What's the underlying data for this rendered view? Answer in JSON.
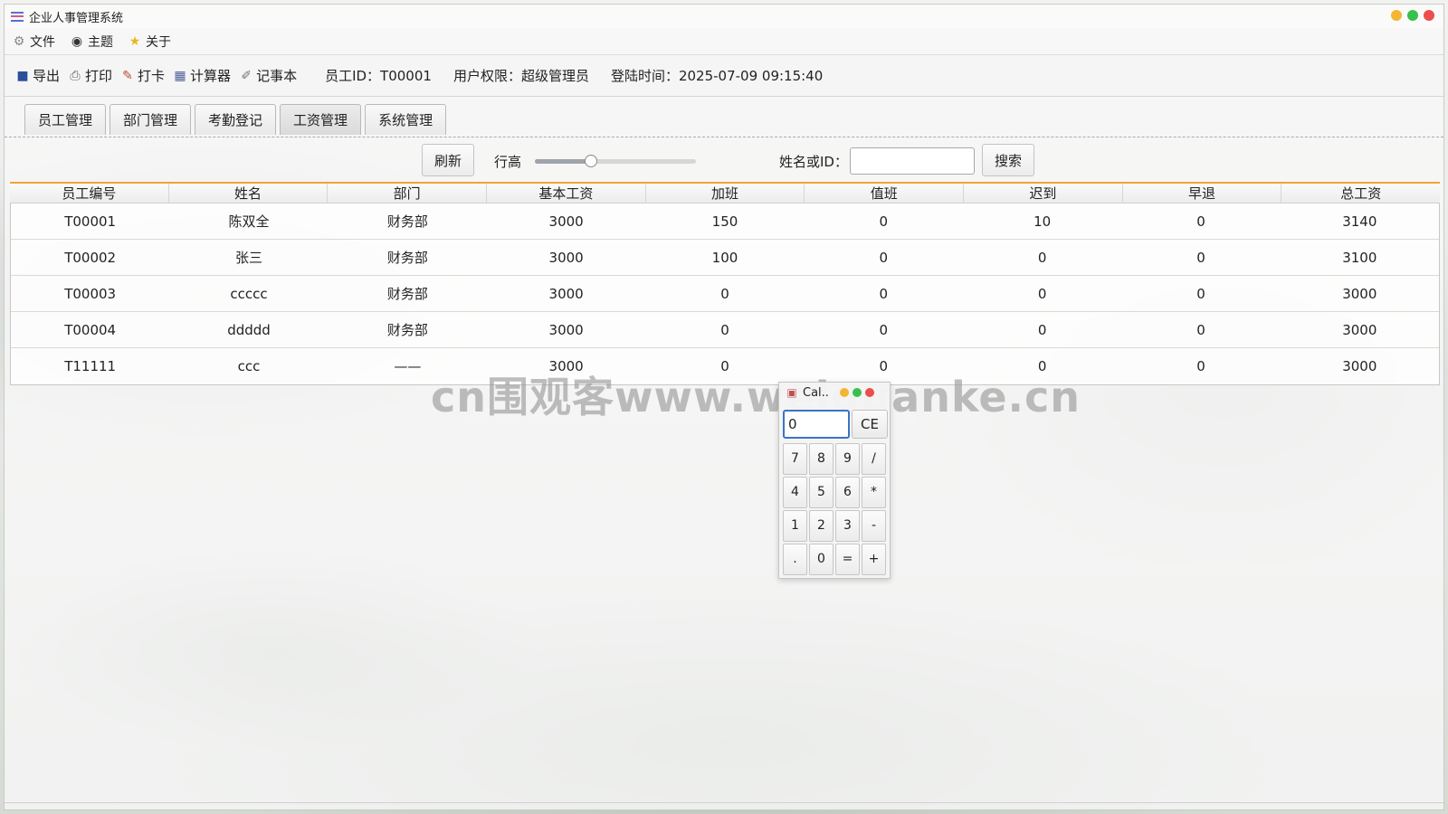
{
  "window": {
    "title": "企业人事管理系统"
  },
  "menu": [
    {
      "label": "文件",
      "icon": "gear-icon"
    },
    {
      "label": "主题",
      "icon": "eye-icon"
    },
    {
      "label": "关于",
      "icon": "star-icon"
    }
  ],
  "toolbar": {
    "tools": [
      {
        "label": "导出",
        "icon": "save-icon"
      },
      {
        "label": "打印",
        "icon": "printer-icon"
      },
      {
        "label": "打卡",
        "icon": "clipboard-check-icon"
      },
      {
        "label": "计算器",
        "icon": "calculator-icon"
      },
      {
        "label": "记事本",
        "icon": "notepad-icon"
      }
    ],
    "employee_id": "员工ID：T00001",
    "permission": "用户权限：超级管理员",
    "login_time": "登陆时间：2025-07-09 09:15:40"
  },
  "tabs": [
    "员工管理",
    "部门管理",
    "考勤登记",
    "工资管理",
    "系统管理"
  ],
  "active_tab": "工资管理",
  "controls": {
    "refresh_label": "刷新",
    "row_height_label": "行高",
    "row_height_value": 0.35,
    "search_label": "姓名或ID：",
    "search_value": "",
    "search_button": "搜索"
  },
  "table": {
    "columns": [
      "员工编号",
      "姓名",
      "部门",
      "基本工资",
      "加班",
      "值班",
      "迟到",
      "早退",
      "总工资"
    ],
    "rows": [
      [
        "T00001",
        "陈双全",
        "财务部",
        "3000",
        "150",
        "0",
        "10",
        "0",
        "3140"
      ],
      [
        "T00002",
        "张三",
        "财务部",
        "3000",
        "100",
        "0",
        "0",
        "0",
        "3100"
      ],
      [
        "T00003",
        "ccccc",
        "财务部",
        "3000",
        "0",
        "0",
        "0",
        "0",
        "3000"
      ],
      [
        "T00004",
        "ddddd",
        "财务部",
        "3000",
        "0",
        "0",
        "0",
        "0",
        "3000"
      ],
      [
        "T11111",
        "ccc",
        "——",
        "3000",
        "0",
        "0",
        "0",
        "0",
        "3000"
      ]
    ]
  },
  "calculator": {
    "title": "Cal..",
    "display": "0",
    "ce_label": "CE",
    "keys": [
      "7",
      "8",
      "9",
      "/",
      "4",
      "5",
      "6",
      "*",
      "1",
      "2",
      "3",
      "-",
      ".",
      "0",
      "=",
      "+"
    ]
  },
  "watermark": "cn围观客www.weiguanke.cn",
  "colors": {
    "accent": "#f2a23c",
    "close": "#ec4d4d",
    "maximize": "#37c04d",
    "minimize": "#f2b632",
    "focus": "#3b73c4"
  }
}
